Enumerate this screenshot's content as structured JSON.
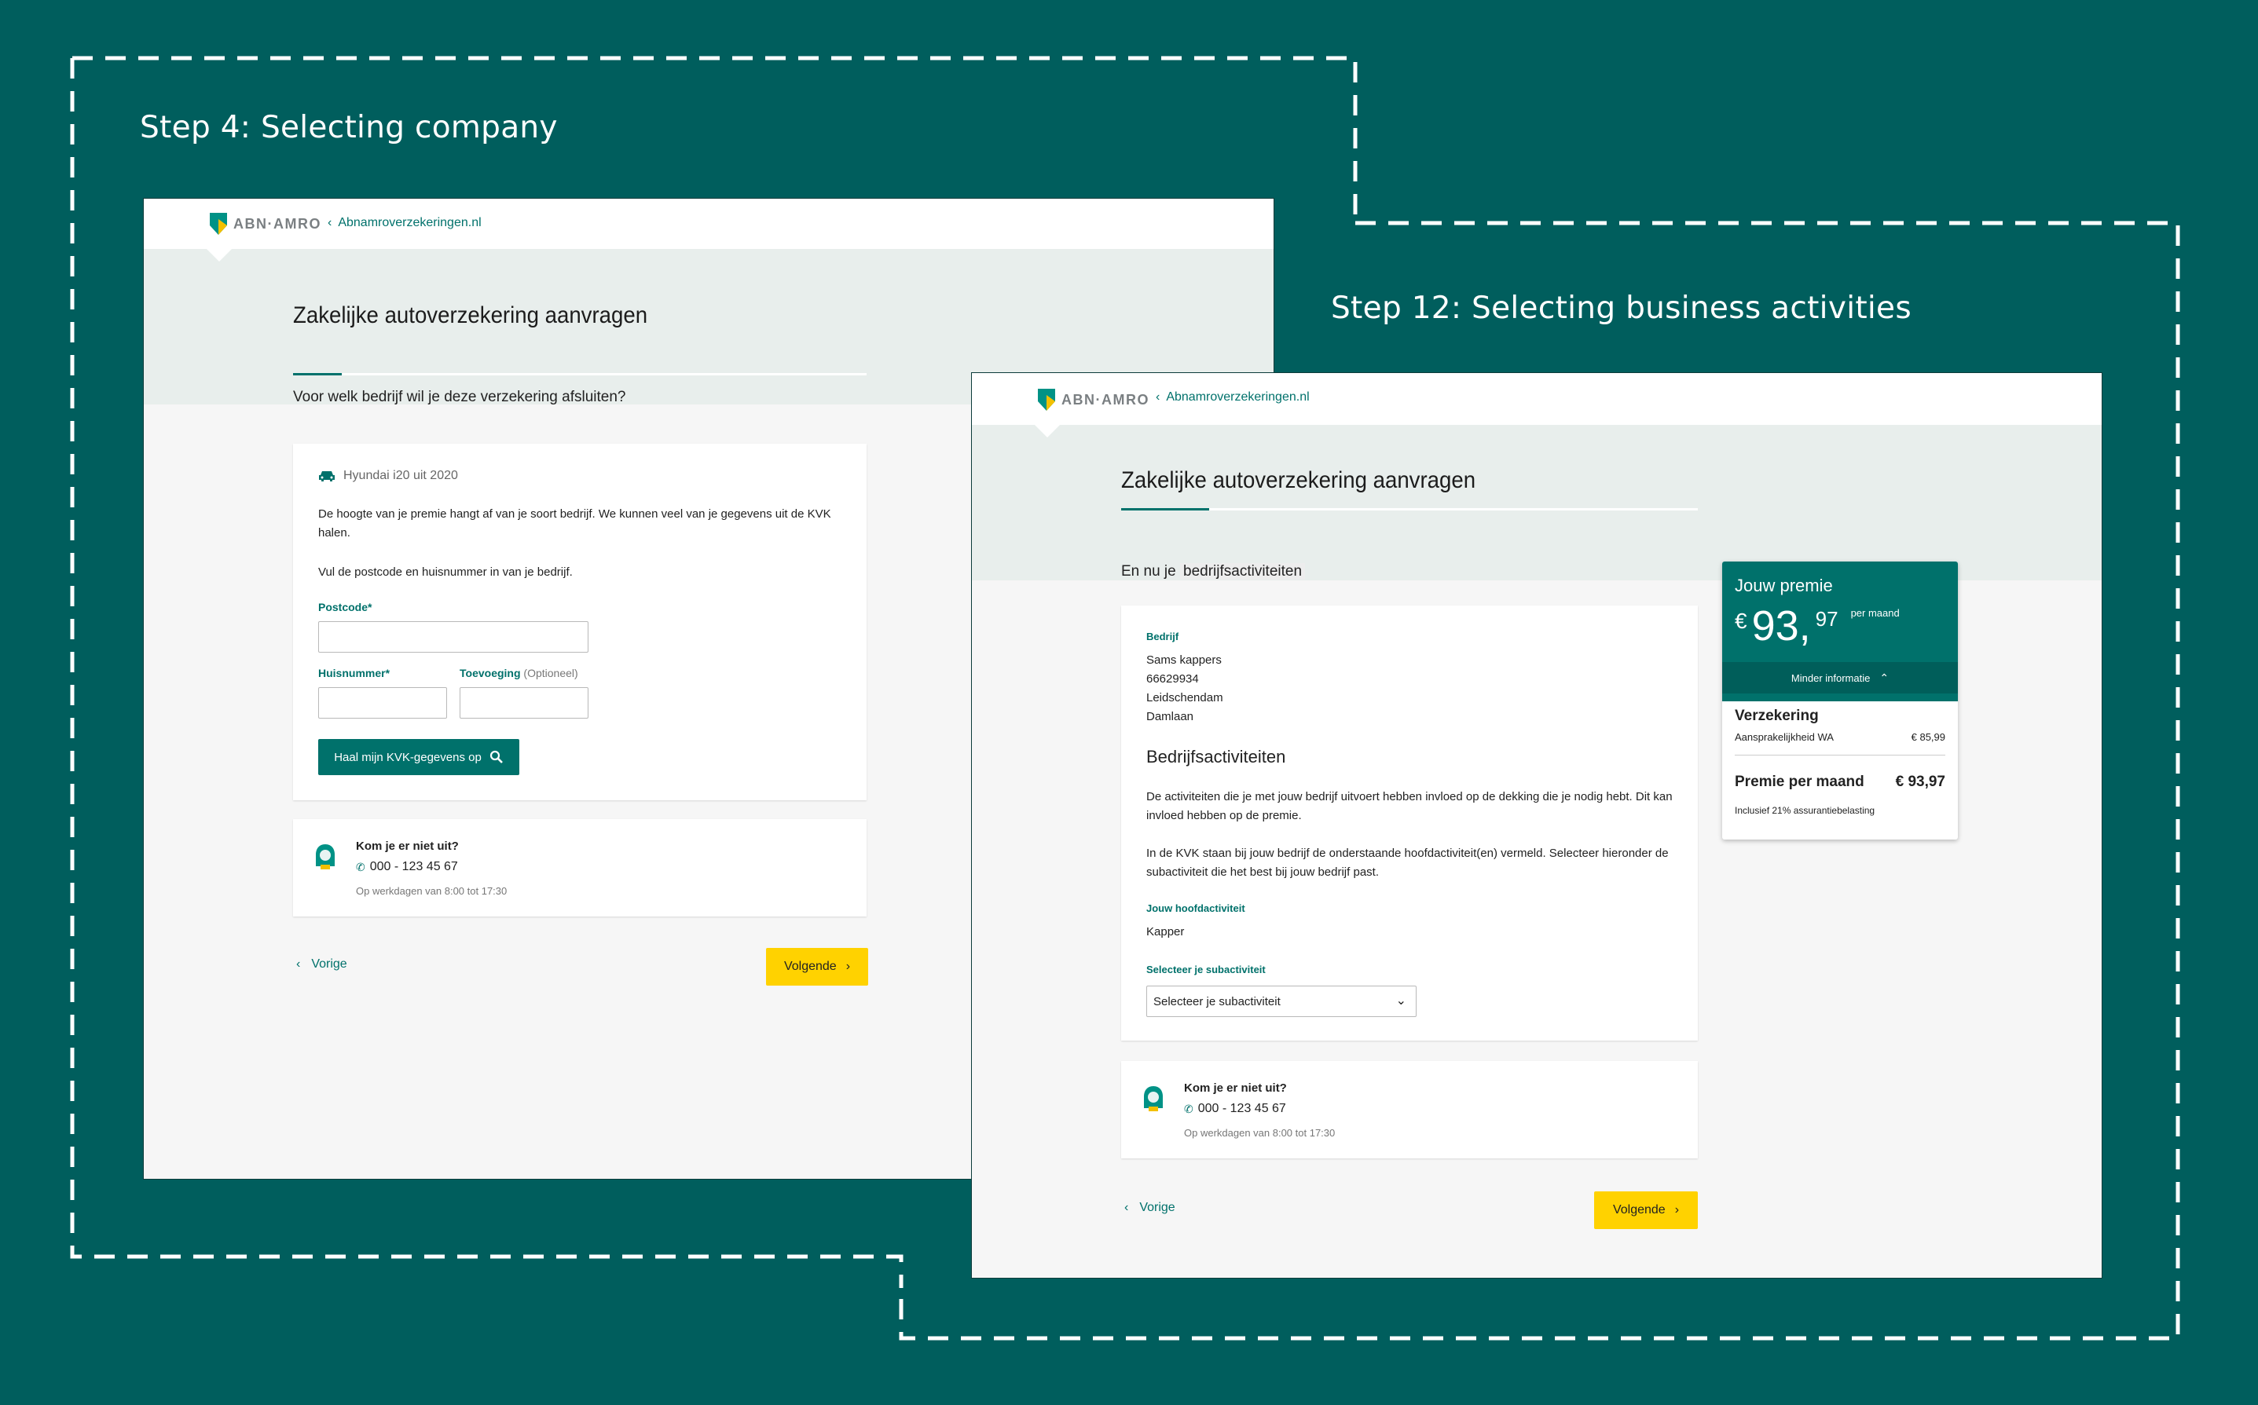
{
  "colors": {
    "background": "#005e5d",
    "brand_green": "#00716b",
    "accent_yellow": "#ffd200",
    "hero_bg": "#e8eeec"
  },
  "step4": {
    "title": "Step 4: Selecting company",
    "brand": "ABN·AMRO",
    "back_link": "Abnamroverzekeringen.nl",
    "heading": "Zakelijke autoverzekering aanvragen",
    "question": "Voor welk bedrijf wil je deze verzekering afsluiten?",
    "car": "Hyundai i20 uit 2020",
    "intro": "De hoogte van je premie hangt af van je soort bedrijf. We kunnen veel van je gegevens uit de KVK halen.",
    "instruction": "Vul de postcode en huisnummer in van je bedrijf.",
    "postcode_label": "Postcode*",
    "huisnummer_label": "Huisnummer*",
    "toevoeging_label": "Toevoeging",
    "toevoeging_optional": "(Optioneel)",
    "fetch_button": "Haal mijn KVK-gegevens op",
    "help_title": "Kom je er niet uit?",
    "help_phone": "000 - 123 45 67",
    "help_hours": "Op werkdagen van 8:00 tot 17:30",
    "prev": "Vorige",
    "next": "Volgende"
  },
  "step12": {
    "title": "Step 12: Selecting business activities",
    "brand": "ABN·AMRO",
    "back_link": "Abnamroverzekeringen.nl",
    "heading": "Zakelijke autoverzekering aanvragen",
    "question_prefix": "En nu je ",
    "question_highlight": "bedrijfsactiviteiten",
    "company_label": "Bedrijf",
    "company": {
      "name": "Sams kappers",
      "number": "66629934",
      "city": "Leidschendam",
      "street": "Damlaan"
    },
    "section_title": "Bedrijfsactiviteiten",
    "para1": "De activiteiten die je met jouw bedrijf uitvoert hebben invloed op de dekking die je nodig hebt. Dit kan invloed hebben op de premie.",
    "para2": "In de KVK staan bij jouw bedrijf de onderstaande hoofdactiviteit(en) vermeld. Selecteer hieronder de subactiviteit die het best bij jouw bedrijf past.",
    "main_activity_label": "Jouw hoofdactiviteit",
    "main_activity": "Kapper",
    "sub_label": "Selecteer je subactiviteit",
    "sub_placeholder": "Selecteer je subactiviteit",
    "help_title": "Kom je er niet uit?",
    "help_phone": "000 - 123 45 67",
    "help_hours": "Op werkdagen van 8:00 tot 17:30",
    "prev": "Vorige",
    "next": "Volgende",
    "premium": {
      "title": "Jouw premie",
      "currency": "€",
      "amount_main": "93,",
      "amount_cents": "97",
      "per": "per maand",
      "toggle": "Minder informatie",
      "section": "Verzekering",
      "item_label": "Aansprakelijkheid WA",
      "item_value": "€ 85,99",
      "total_label": "Premie per maand",
      "total_value": "€ 93,97",
      "tax_note": "Inclusief 21% assurantiebelasting"
    }
  }
}
